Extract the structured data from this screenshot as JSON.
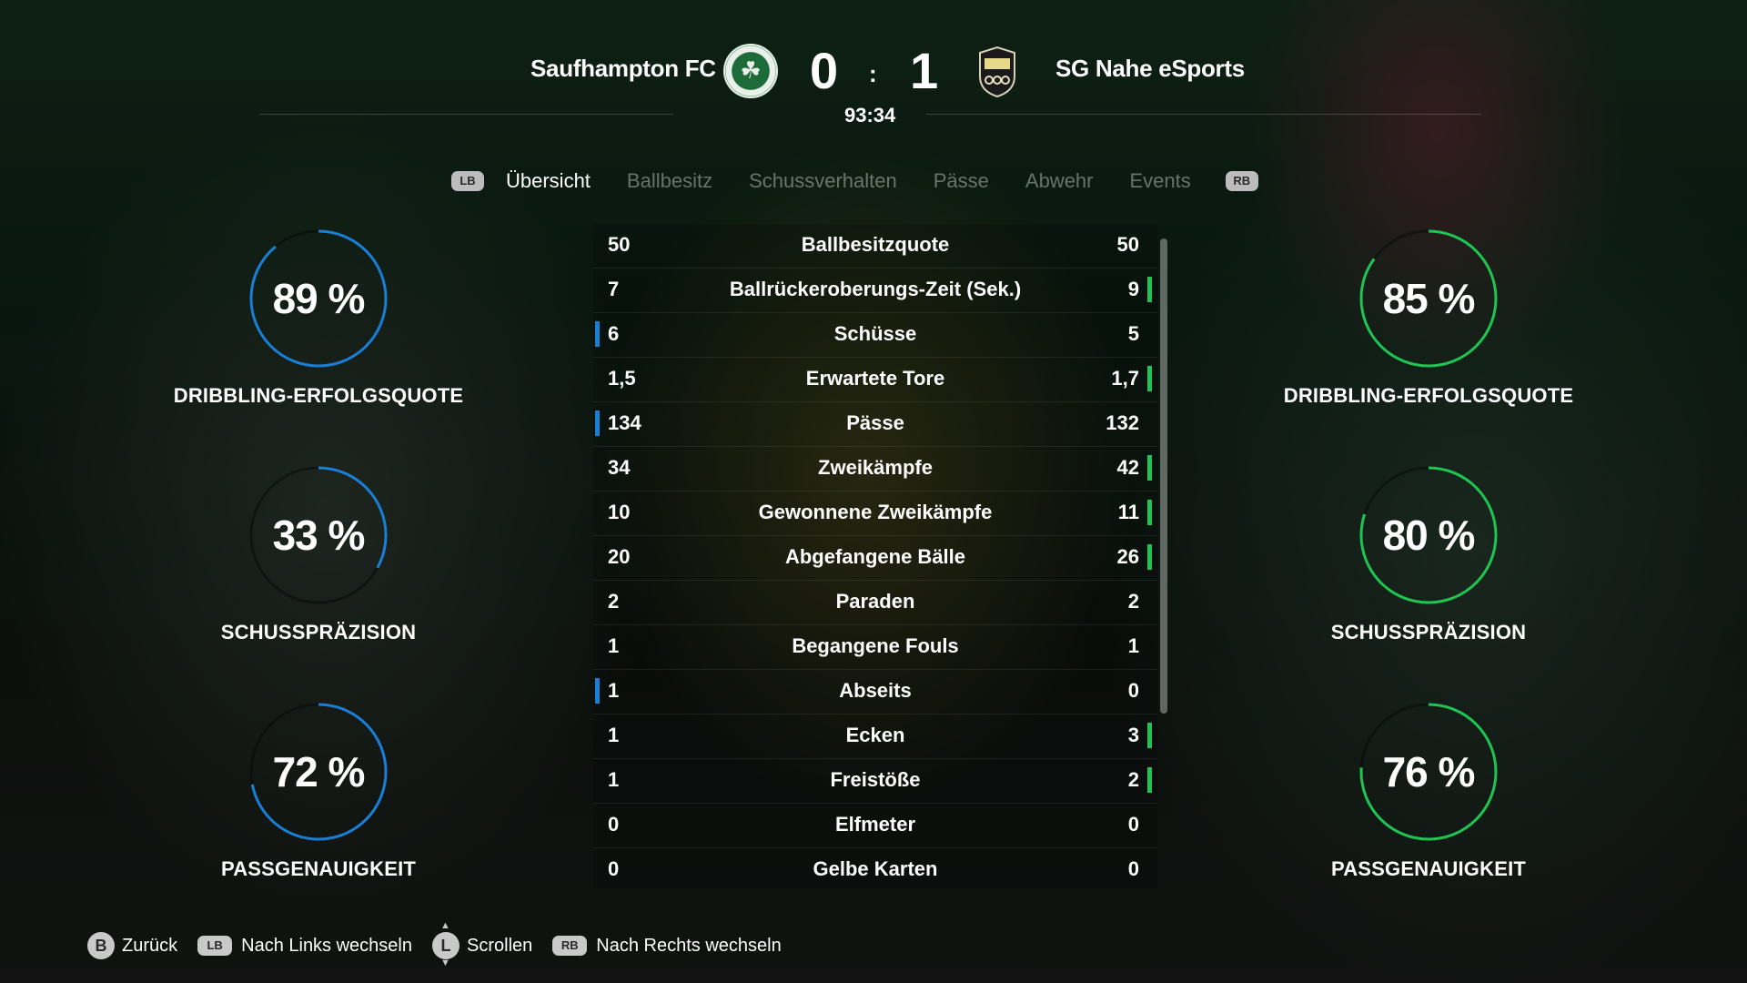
{
  "match": {
    "home_team": "Saufhampton FC",
    "away_team": "SG Nahe eSports",
    "home_score": "0",
    "score_separator": ":",
    "away_score": "1",
    "clock": "93:34",
    "home_crest_icon": "celtic-clover-crest-icon",
    "away_crest_icon": "lion-shield-crest-icon"
  },
  "tabs": {
    "lb": "LB",
    "rb": "RB",
    "items": [
      "Übersicht",
      "Ballbesitz",
      "Schussverhalten",
      "Pässe",
      "Abwehr",
      "Events"
    ],
    "active_index": 0
  },
  "colors": {
    "home_accent": "#1a7fd4",
    "away_accent": "#1fc452"
  },
  "home_rings": [
    {
      "value_text": "89 %",
      "fraction": 0.89,
      "label": "DRIBBLING-ERFOLGSQUOTE"
    },
    {
      "value_text": "33 %",
      "fraction": 0.33,
      "label": "SCHUSSPRÄZISION"
    },
    {
      "value_text": "72 %",
      "fraction": 0.72,
      "label": "PASSGENAUIGKEIT"
    }
  ],
  "away_rings": [
    {
      "value_text": "85 %",
      "fraction": 0.85,
      "label": "DRIBBLING-ERFOLGSQUOTE"
    },
    {
      "value_text": "80 %",
      "fraction": 0.8,
      "label": "SCHUSSPRÄZISION"
    },
    {
      "value_text": "76 %",
      "fraction": 0.76,
      "label": "PASSGENAUIGKEIT"
    }
  ],
  "stats": [
    {
      "name": "Ballbesitzquote",
      "home": "50",
      "away": "50",
      "leader": "none"
    },
    {
      "name": "Ballrückeroberungs-Zeit (Sek.)",
      "home": "7",
      "away": "9",
      "leader": "away"
    },
    {
      "name": "Schüsse",
      "home": "6",
      "away": "5",
      "leader": "home"
    },
    {
      "name": "Erwartete Tore",
      "home": "1,5",
      "away": "1,7",
      "leader": "away"
    },
    {
      "name": "Pässe",
      "home": "134",
      "away": "132",
      "leader": "home"
    },
    {
      "name": "Zweikämpfe",
      "home": "34",
      "away": "42",
      "leader": "away"
    },
    {
      "name": "Gewonnene Zweikämpfe",
      "home": "10",
      "away": "11",
      "leader": "away"
    },
    {
      "name": "Abgefangene Bälle",
      "home": "20",
      "away": "26",
      "leader": "away"
    },
    {
      "name": "Paraden",
      "home": "2",
      "away": "2",
      "leader": "none"
    },
    {
      "name": "Begangene Fouls",
      "home": "1",
      "away": "1",
      "leader": "none"
    },
    {
      "name": "Abseits",
      "home": "1",
      "away": "0",
      "leader": "home"
    },
    {
      "name": "Ecken",
      "home": "1",
      "away": "3",
      "leader": "away"
    },
    {
      "name": "Freistöße",
      "home": "1",
      "away": "2",
      "leader": "away"
    },
    {
      "name": "Elfmeter",
      "home": "0",
      "away": "0",
      "leader": "none"
    },
    {
      "name": "Gelbe Karten",
      "home": "0",
      "away": "0",
      "leader": "none"
    }
  ],
  "footer": {
    "back_key": "B",
    "back_label": "Zurück",
    "left_key": "LB",
    "left_label": "Nach Links wechseln",
    "scroll_key": "L",
    "scroll_label": "Scrollen",
    "right_key": "RB",
    "right_label": "Nach Rechts wechseln"
  }
}
